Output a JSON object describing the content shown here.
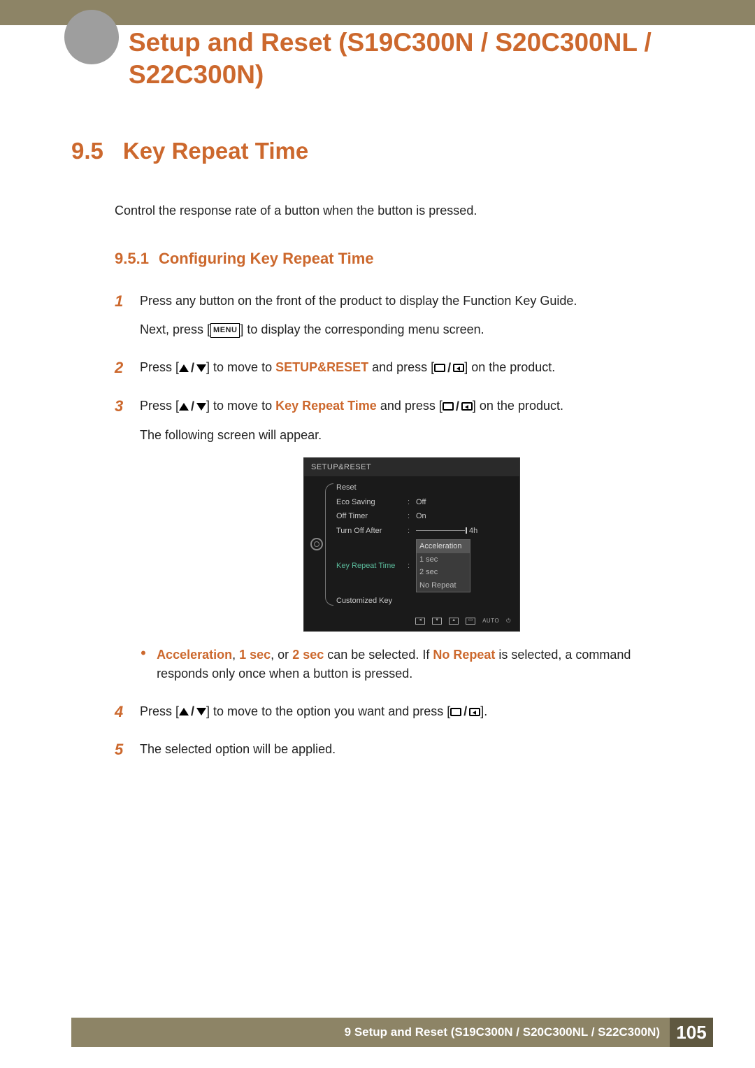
{
  "header": {
    "title": "Setup and Reset (S19C300N / S20C300NL / S22C300N)"
  },
  "section": {
    "num": "9.5",
    "title": "Key Repeat Time",
    "intro": "Control the response rate of a button when the button is pressed."
  },
  "subsection": {
    "num": "9.5.1",
    "title": "Configuring Key Repeat Time"
  },
  "steps": {
    "s1": {
      "num": "1",
      "line1": "Press any button on the front of the product to display the Function Key Guide.",
      "line2a": "Next, press [",
      "menu": "MENU",
      "line2b": "] to display the corresponding menu screen."
    },
    "s2": {
      "num": "2",
      "prefix": "Press [",
      "mid": "] to move to ",
      "target": "SETUP&RESET",
      "mid2": " and press [",
      "suffix": "] on the product."
    },
    "s3": {
      "num": "3",
      "prefix": "Press [",
      "mid": "] to move to ",
      "target": "Key Repeat Time",
      "mid2": " and press [",
      "suffix": "] on the product.",
      "line2": "The following screen will appear."
    },
    "s4": {
      "num": "4",
      "prefix": "Press [",
      "mid": "] to move to the option you want and press [",
      "suffix": "]."
    },
    "s5": {
      "num": "5",
      "text": "The selected option will be applied."
    }
  },
  "bullet": {
    "a": "Acceleration",
    "sep1": ", ",
    "b": "1 sec",
    "sep2": ", or ",
    "c": "2 sec",
    "mid": " can be selected. If ",
    "d": "No Repeat",
    "tail": " is selected, a command responds only once when a button is pressed."
  },
  "osd": {
    "title": "SETUP&RESET",
    "items": {
      "reset": "Reset",
      "eco": "Eco Saving",
      "eco_val": "Off",
      "offtimer": "Off Timer",
      "offtimer_val": "On",
      "turnoff": "Turn Off After",
      "turnoff_val": "4h",
      "keyrepeat": "Key Repeat Time",
      "custom": "Customized Key"
    },
    "dropdown": {
      "opt1": "Acceleration",
      "opt2": "1 sec",
      "opt3": "2 sec",
      "opt4": "No Repeat"
    },
    "footer": {
      "auto": "AUTO"
    }
  },
  "footer": {
    "text": "9 Setup and Reset (S19C300N / S20C300NL / S22C300N)",
    "page": "105"
  }
}
